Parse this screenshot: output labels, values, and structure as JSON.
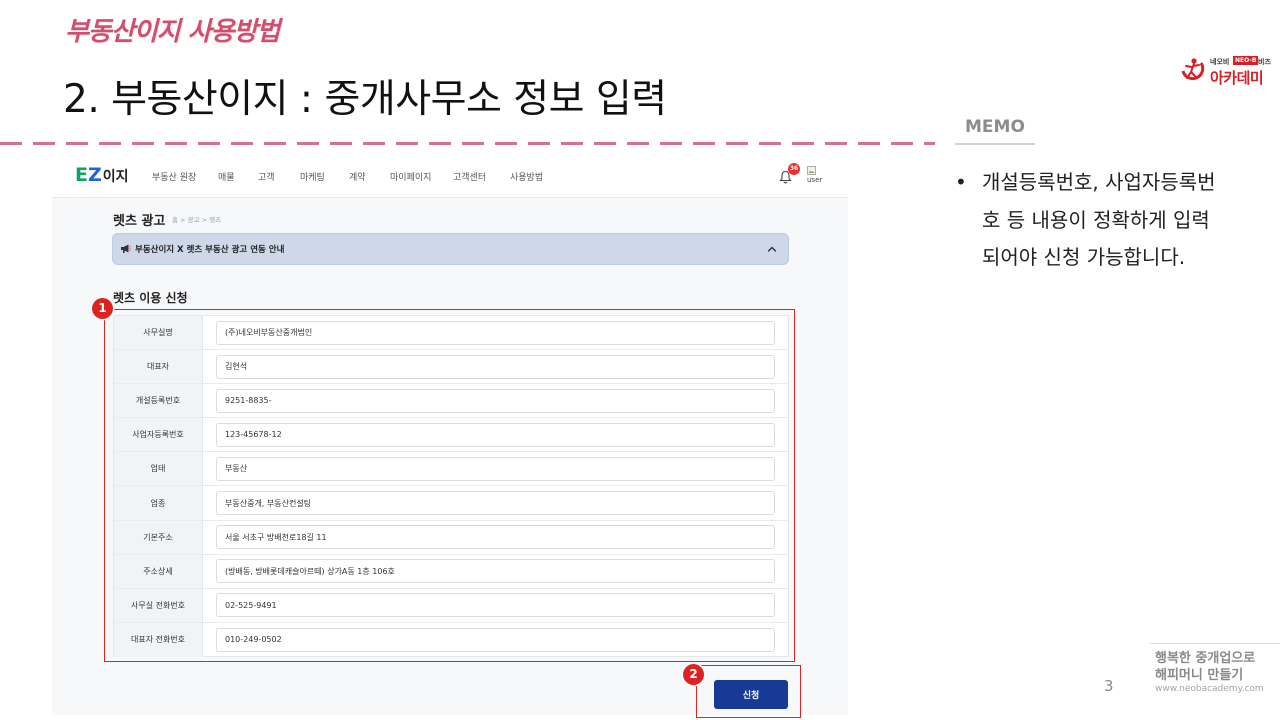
{
  "slide": {
    "header_label": "부동산이지 사용방법",
    "title": "2. 부동산이지 : 중개사무소 정보 입력",
    "page_number": "3"
  },
  "brand_logo": {
    "top_left": "네오비",
    "badge": "NEO-B",
    "top_right": "비즈",
    "main": "아카데미",
    "icon": "running-figure-icon"
  },
  "memo": {
    "label": "MEMO",
    "bullet": "•",
    "lines": [
      "개설등록번호, 사업자등록번",
      "호 등 내용이 정확하게 입력",
      "되어야 신청 가능합니다."
    ]
  },
  "footer": {
    "slogan_line1": "행복한 중개업으로",
    "slogan_line2": "해피머니 만들기",
    "website": "www.neobacademy.com"
  },
  "callouts": {
    "first": "1",
    "second": "2"
  },
  "app": {
    "logo": {
      "mark_e": "E",
      "mark_z": "Z",
      "name": "이지"
    },
    "nav": {
      "items": [
        "부동산 원장",
        "매물",
        "고객",
        "마케팅",
        "계약",
        "마이페이지",
        "고객센터",
        "사용방법"
      ]
    },
    "notifications": {
      "icon": "bell-icon",
      "count": "36"
    },
    "user": {
      "alt": "user",
      "icon": "broken-image-icon"
    },
    "page": {
      "title": "렛츠 광고",
      "breadcrumb": "홈 > 광고 > 렛츠"
    },
    "notice": {
      "icon": "megaphone-icon",
      "text": "부동산이지 X 렛츠 부동산 광고 연동 안내",
      "toggle_icon": "chevron-up-icon"
    },
    "form": {
      "title": "렛츠 이용 신청",
      "fields": [
        {
          "label": "사무실명",
          "value": "(주)네오비부동산중개법인"
        },
        {
          "label": "대표자",
          "value": "김현석"
        },
        {
          "label": "개설등록번호",
          "value": "9251-8835-"
        },
        {
          "label": "사업자등록번호",
          "value": "123-45678-12"
        },
        {
          "label": "업태",
          "value": "부동산"
        },
        {
          "label": "업종",
          "value": "부동산중개, 부동산컨설팅"
        },
        {
          "label": "기본주소",
          "value": "서울 서초구 방배천로18길 11"
        },
        {
          "label": "주소상세",
          "value": "(방배동, 방배롯데캐슬아르떼) 상가A동 1층 106호"
        },
        {
          "label": "사무실 전화번호",
          "value": "02-525-9491"
        },
        {
          "label": "대표자 전화번호",
          "value": "010-249-0502"
        }
      ],
      "submit_label": "신청"
    }
  },
  "colors": {
    "accent": "#d44d6e",
    "callout_red": "#dd2222",
    "button_blue": "#173a96",
    "notice_bg": "#cdd8e9",
    "logo_red": "#d71f26",
    "ez_green": "#12a160",
    "ez_blue": "#2563d6"
  }
}
